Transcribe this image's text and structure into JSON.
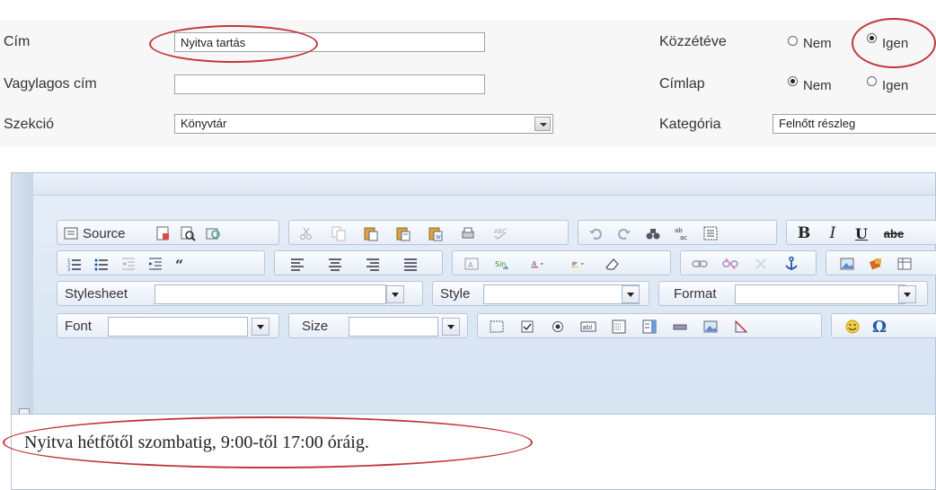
{
  "form": {
    "cim_label": "Cím",
    "cim_value": "Nyitva tartás",
    "alt_cim_label": "Vagylagos cím",
    "alt_cim_value": "",
    "szekcio_label": "Szekció",
    "szekcio_value": "Könyvtár",
    "kozzeteve_label": "Közzétéve",
    "kozzeteve_no": "Nem",
    "kozzeteve_yes": "Igen",
    "kozzeteve_selected": "Igen",
    "cimlap_label": "Címlap",
    "cimlap_no": "Nem",
    "cimlap_yes": "Igen",
    "cimlap_selected": "Nem",
    "kategoria_label": "Kategória",
    "kategoria_value": "Felnőtt részleg"
  },
  "editor": {
    "source_label": "Source",
    "stylesheet_label": "Stylesheet",
    "style_label": "Style",
    "format_label": "Format",
    "font_label": "Font",
    "size_label": "Size",
    "bold": "B",
    "italic": "I",
    "underline": "U",
    "strike": "abe",
    "content": "Nyitva hétfőtől szombatig, 9:00-től 17:00 óráig."
  },
  "colors": {
    "annotation": "#c0363a",
    "toolbar_bg": "#dbe6f3"
  }
}
